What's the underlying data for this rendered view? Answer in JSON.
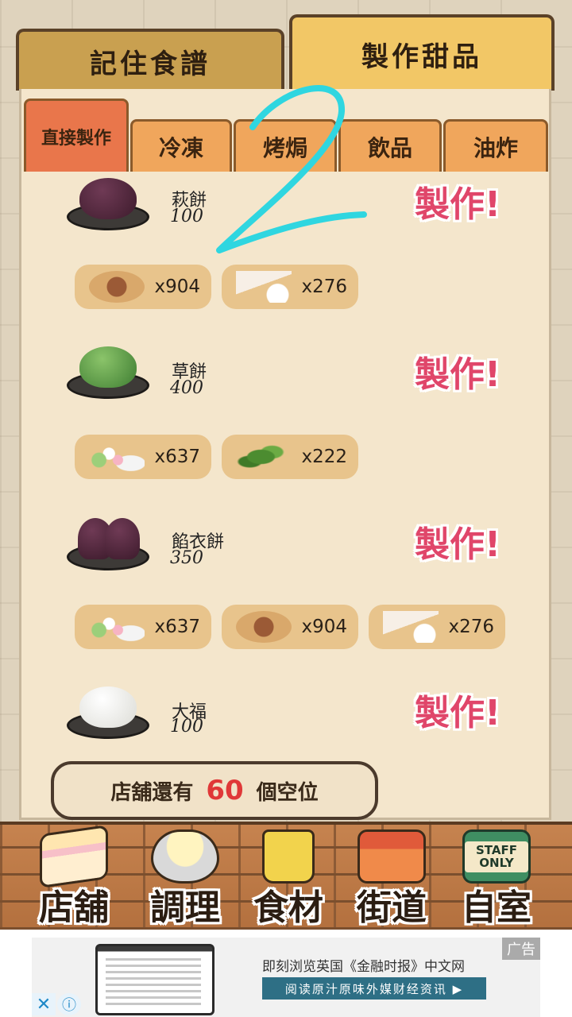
{
  "top_tabs": [
    {
      "label": "記住食譜"
    },
    {
      "label": "製作甜品"
    }
  ],
  "sub_tabs": [
    {
      "label": "直接製作"
    },
    {
      "label": "冷凍"
    },
    {
      "label": "烤焗"
    },
    {
      "label": "飲品"
    },
    {
      "label": "油炸"
    }
  ],
  "make_label": "製作!",
  "recipes": [
    {
      "name": "萩餅",
      "price": "100",
      "ingredients": [
        {
          "icon": "sugar-icon",
          "qty": "x904"
        },
        {
          "icon": "flour-icon",
          "qty": "x276"
        }
      ]
    },
    {
      "name": "草餅",
      "price": "400",
      "ingredients": [
        {
          "icon": "dango-icon",
          "qty": "x637"
        },
        {
          "icon": "herb-icon",
          "qty": "x222"
        }
      ]
    },
    {
      "name": "餡衣餅",
      "price": "350",
      "ingredients": [
        {
          "icon": "dango-icon",
          "qty": "x637"
        },
        {
          "icon": "sugar-icon",
          "qty": "x904"
        },
        {
          "icon": "flour-icon",
          "qty": "x276"
        }
      ]
    },
    {
      "name": "大福",
      "price": "100",
      "ingredients": []
    }
  ],
  "seats": {
    "prefix": "店舖還有",
    "count": "60",
    "suffix": "個空位"
  },
  "nav": [
    {
      "label": "店舖",
      "icon": "cake-icon"
    },
    {
      "label": "調理",
      "icon": "mixing-bowl-icon"
    },
    {
      "label": "食材",
      "icon": "flour-bag-icon"
    },
    {
      "label": "街道",
      "icon": "shop-icon"
    },
    {
      "label": "自室",
      "icon": "staff-only-sign-icon"
    }
  ],
  "staff_sign": "STAFF ONLY",
  "ad": {
    "title": "即刻浏览英国《金融时报》中文网",
    "cta": "阅读原汁原味外媒财经资讯 ▶",
    "label": "广告",
    "close": "✕",
    "info": "ⓘ"
  },
  "colors": {
    "make": "#e0466a",
    "seat_count": "#e03838",
    "scribble": "#2fd6e0"
  }
}
